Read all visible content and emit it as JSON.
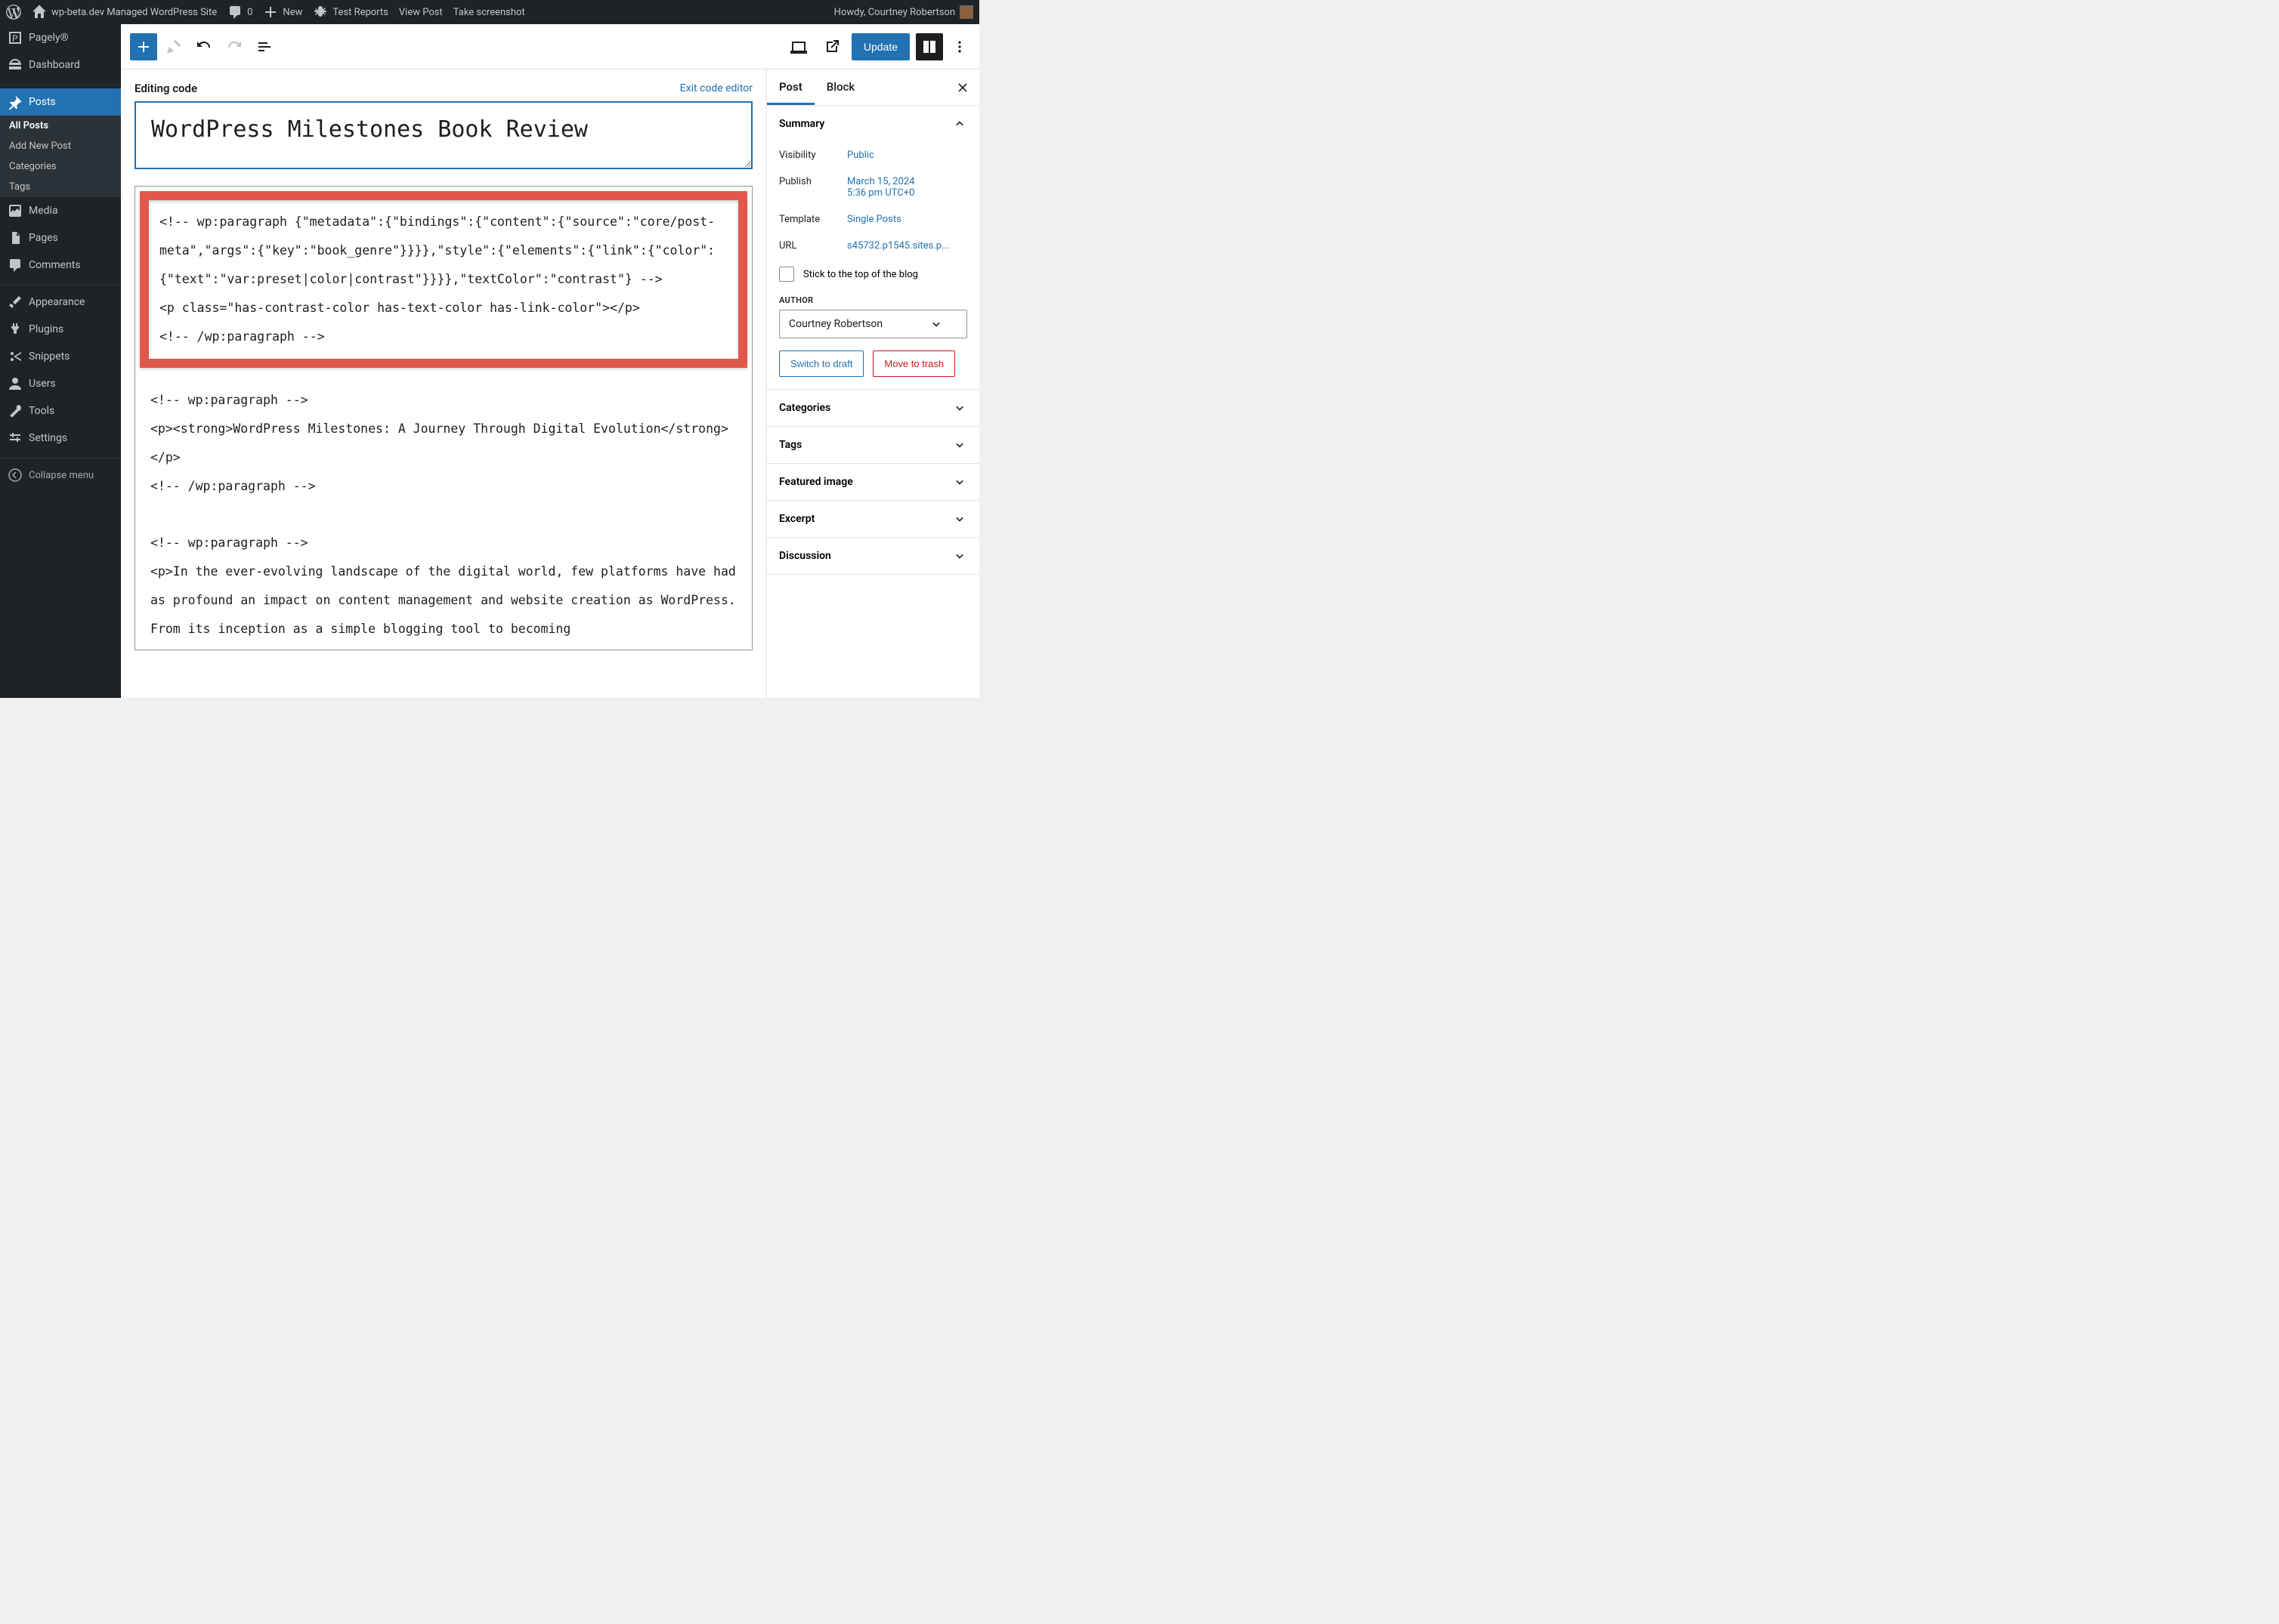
{
  "adminbar": {
    "site_name": "wp-beta.dev Managed WordPress Site",
    "comment_count": "0",
    "new_label": "New",
    "test_reports": "Test Reports",
    "view_post": "View Post",
    "take_screenshot": "Take screenshot",
    "howdy": "Howdy, Courtney Robertson"
  },
  "sidebar": {
    "pagely": "Pagely®",
    "dashboard": "Dashboard",
    "posts": "Posts",
    "posts_sub": {
      "all": "All Posts",
      "add": "Add New Post",
      "categories": "Categories",
      "tags": "Tags"
    },
    "media": "Media",
    "pages": "Pages",
    "comments": "Comments",
    "appearance": "Appearance",
    "plugins": "Plugins",
    "snippets": "Snippets",
    "users": "Users",
    "tools": "Tools",
    "settings": "Settings",
    "collapse": "Collapse menu"
  },
  "toolbar": {
    "update": "Update"
  },
  "editor": {
    "editing_code": "Editing code",
    "exit_code": "Exit code editor",
    "title": "WordPress Milestones Book Review",
    "code_highlighted": "<!-- wp:paragraph {\"metadata\":{\"bindings\":{\"content\":{\"source\":\"core/post-meta\",\"args\":{\"key\":\"book_genre\"}}}},\"style\":{\"elements\":{\"link\":{\"color\":{\"text\":\"var:preset|color|contrast\"}}}},\"textColor\":\"contrast\"} -->\n<p class=\"has-contrast-color has-text-color has-link-color\"></p>\n<!-- /wp:paragraph -->",
    "code_rest": "<!-- wp:paragraph -->\n<p><strong>WordPress Milestones: A Journey Through Digital Evolution</strong></p>\n<!-- /wp:paragraph -->\n\n<!-- wp:paragraph -->\n<p>In the ever-evolving landscape of the digital world, few platforms have had as profound an impact on content management and website creation as WordPress. From its inception as a simple blogging tool to becoming"
  },
  "settings": {
    "tabs": {
      "post": "Post",
      "block": "Block"
    },
    "summary": {
      "title": "Summary",
      "visibility_label": "Visibility",
      "visibility_value": "Public",
      "publish_label": "Publish",
      "publish_value_line1": "March 15, 2024",
      "publish_value_line2": "5:36 pm UTC+0",
      "template_label": "Template",
      "template_value": "Single Posts",
      "url_label": "URL",
      "url_value": "s45732.p1545.sites.p...",
      "stick_label": "Stick to the top of the blog",
      "author_label": "AUTHOR",
      "author_value": "Courtney Robertson",
      "switch_draft": "Switch to draft",
      "move_trash": "Move to trash"
    },
    "panels": {
      "categories": "Categories",
      "tags": "Tags",
      "featured_image": "Featured image",
      "excerpt": "Excerpt",
      "discussion": "Discussion"
    }
  }
}
